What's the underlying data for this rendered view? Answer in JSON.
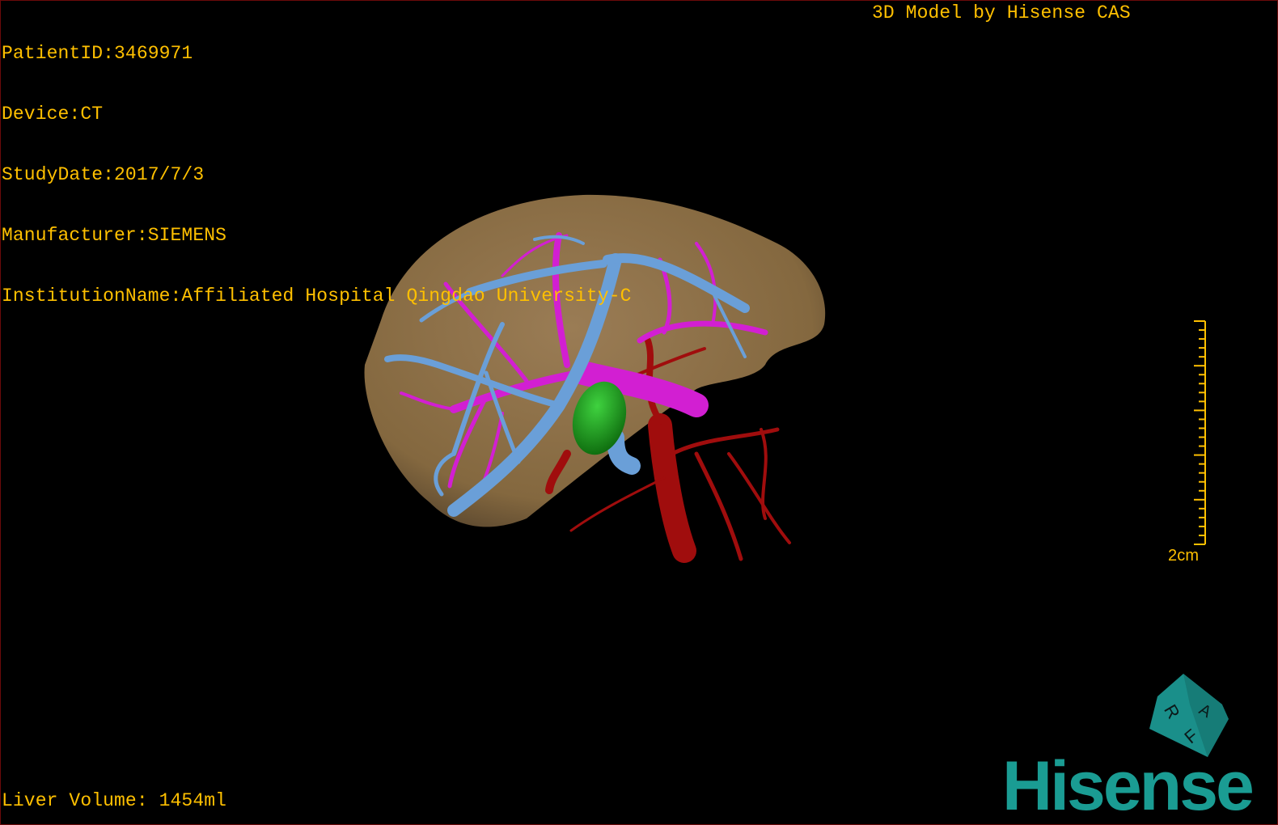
{
  "info": {
    "patient_id": "PatientID:3469971",
    "device": "Device:CT",
    "study_date": "StudyDate:2017/7/3",
    "manufacturer": "Manufacturer:SIEMENS",
    "institution": "InstitutionName:Affiliated Hospital Qingdao University-C"
  },
  "brand_label": "3D Model by Hisense CAS",
  "liver_volume": "Liver Volume: 1454ml",
  "scale_bar": {
    "label": "2cm",
    "ticks": 26,
    "major_every": 5
  },
  "orientation_cube": {
    "faces": [
      "A",
      "R",
      "F"
    ],
    "color": "#1a8f8a"
  },
  "logo": "Hisense",
  "colors": {
    "overlay_text": "#ffc000",
    "liver": "#8a6d48",
    "hepatic_vein": "#6a9fd8",
    "portal_vein": "#d21fd2",
    "artery": "#a00d0d",
    "lesion": "#1f9a1f",
    "logo": "#1a9c93"
  }
}
